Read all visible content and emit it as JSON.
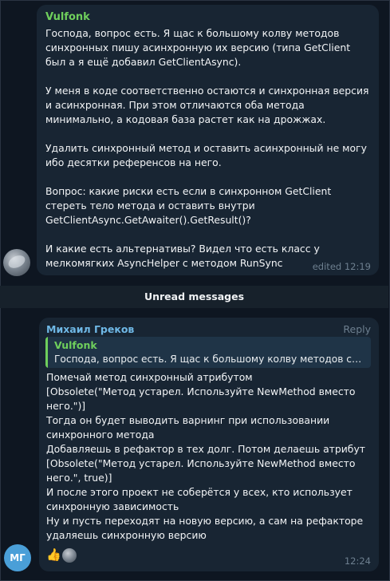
{
  "message1": {
    "sender": "Vulfonk",
    "text": "Господа, вопрос есть. Я щас к большому колву методов синхронных пишу асинхронную их версию (типа GetClient был а я ещё добавил GetClientAsync).\n\nУ меня в коде соответственно остаются и синхронная версия и асинхронная. При этом отличаются оба метода минимально, а кодовая база растет как на дрожжах.\n\nУдалить синхронный метод и оставить асинхронный не могу ибо десятки референсов на него.\n\nВопрос: какие риски есть если в синхронном GetClient стереть тело метода и оставить внутри GetClientAsync.GetAwaiter().GetResult()?\n\nИ какие есть альтернативы? Видел что есть класс у мелкомягких AsyncHelper с методом RunSync",
    "time": "edited 12:19",
    "avatar_color": "#7c8691"
  },
  "unread_label": "Unread messages",
  "message2": {
    "sender": "Михаил Греков",
    "sender_color": "#6fb8e6",
    "reply_label": "Reply",
    "quote": {
      "name": "Vulfonk",
      "text": "Господа, вопрос есть. Я щас к большому колву методов синх..."
    },
    "text": "Помечай метод синхронный атрибутом\n[Obsolete(\"Метод устарел. Используйте NewMethod вместо него.\")]\nТогда он будет выводить варнинг при использовании синхронного метода\nДобавляешь в рефактор в тех долг. Потом делаешь атрибут [Obsolete(\"Метод устарел. Используйте NewMethod вместо него.\", true)]\nИ после этого проект не соберётся у всех, кто использует синхронную зависимость\nНу и пусть переходят на новую версию, а сам на рефакторе удаляешь синхронную версию",
    "reaction_emoji": "👍",
    "time": "12:24",
    "avatar_initials": "МГ",
    "avatar_color": "#4a9fd8"
  }
}
